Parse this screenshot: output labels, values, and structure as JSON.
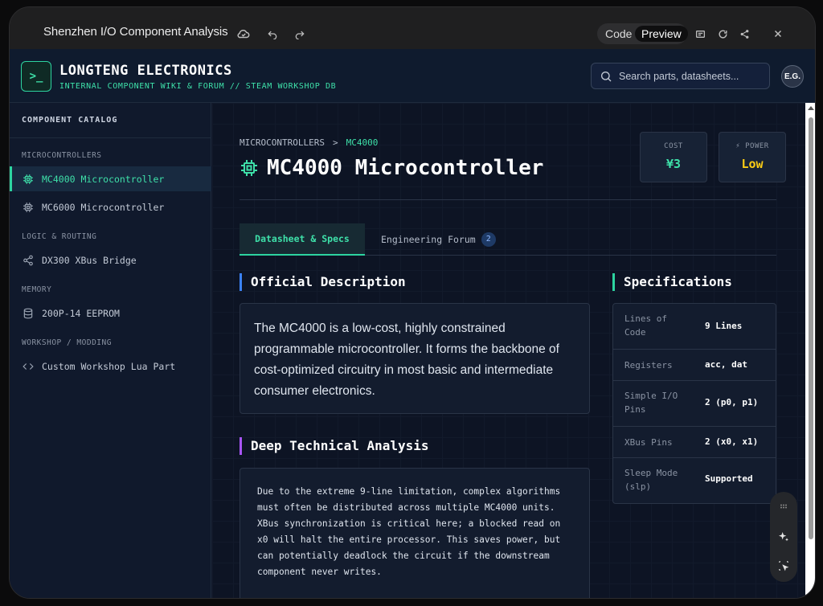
{
  "app": {
    "title": "Shenzhen I/O Component Analysis",
    "toggle": {
      "code": "Code",
      "preview": "Preview"
    }
  },
  "header": {
    "logo_glyph": ">_",
    "brand": "LONGTENG ELECTRONICS",
    "subtitle": "INTERNAL COMPONENT WIKI & FORUM // STEAM WORKSHOP DB",
    "search_placeholder": "Search parts, datasheets...",
    "avatar": "E.G."
  },
  "sidebar": {
    "title": "COMPONENT CATALOG",
    "sections": [
      {
        "label": "MICROCONTROLLERS",
        "items": [
          {
            "label": "MC4000 Microcontroller",
            "icon": "chip-icon",
            "active": true
          },
          {
            "label": "MC6000 Microcontroller",
            "icon": "chip-icon",
            "active": false
          }
        ]
      },
      {
        "label": "LOGIC & ROUTING",
        "items": [
          {
            "label": "DX300 XBus Bridge",
            "icon": "share-icon",
            "active": false
          }
        ]
      },
      {
        "label": "MEMORY",
        "items": [
          {
            "label": "200P-14 EEPROM",
            "icon": "database-icon",
            "active": false
          }
        ]
      },
      {
        "label": "WORKSHOP / MODDING",
        "items": [
          {
            "label": "Custom Workshop Lua Part",
            "icon": "code-icon",
            "active": false
          }
        ]
      }
    ]
  },
  "main": {
    "breadcrumb": {
      "parent": "MICROCONTROLLERS",
      "separator": ">",
      "current": "MC4000"
    },
    "title": "MC4000 Microcontroller",
    "stats": [
      {
        "label": "COST",
        "value": "¥3",
        "color": "#3ee0a9"
      },
      {
        "label": "⚡ POWER",
        "value": "Low",
        "color": "#facc15"
      }
    ],
    "tabs": [
      {
        "label": "Datasheet & Specs",
        "active": true
      },
      {
        "label": "Engineering Forum",
        "badge": "2",
        "active": false
      }
    ],
    "description": {
      "heading": "Official Description",
      "text": "The MC4000 is a low-cost, highly constrained programmable microcontroller. It forms the backbone of cost-optimized circuitry in most basic and intermediate consumer electronics."
    },
    "analysis": {
      "heading": "Deep Technical Analysis",
      "text": "Due to the extreme 9-line limitation, complex algorithms must often be distributed across multiple MC4000 units. XBus synchronization is critical here; a blocked read on x0 will halt the entire processor. This saves power, but can potentially deadlock the circuit if the downstream component never writes."
    },
    "specs": {
      "heading": "Specifications",
      "rows": [
        {
          "key": "Lines of Code",
          "value": "9 Lines"
        },
        {
          "key": "Registers",
          "value": "acc, dat"
        },
        {
          "key": "Simple I/O Pins",
          "value": "2 (p0, p1)"
        },
        {
          "key": "XBus Pins",
          "value": "2 (x0, x1)"
        },
        {
          "key": "Sleep Mode (slp)",
          "value": "Supported"
        }
      ]
    }
  }
}
